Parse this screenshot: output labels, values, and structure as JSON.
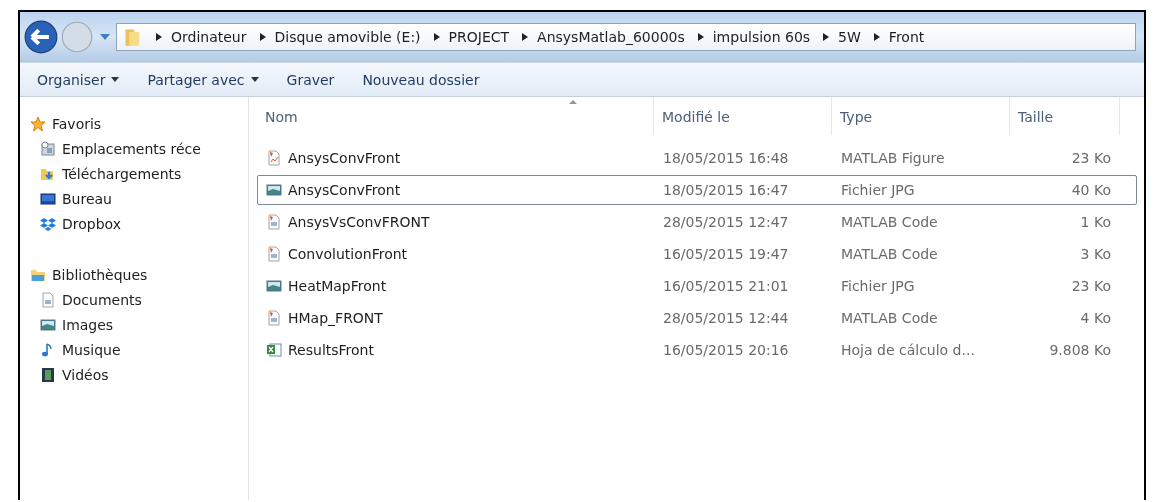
{
  "breadcrumb": [
    "Ordinateur",
    "Disque amovible (E:)",
    "PROJECT",
    "AnsysMatlab_60000s",
    "impulsion 60s",
    "5W",
    "Front"
  ],
  "toolbar": [
    {
      "label": "Organiser",
      "dropdown": true
    },
    {
      "label": "Partager avec",
      "dropdown": true
    },
    {
      "label": "Graver",
      "dropdown": false
    },
    {
      "label": "Nouveau dossier",
      "dropdown": false
    }
  ],
  "sidebar": {
    "groups": [
      {
        "label": "Favoris",
        "kind": "star",
        "items": [
          {
            "label": "Emplacements réce",
            "kind": "recent"
          },
          {
            "label": "Téléchargements",
            "kind": "download"
          },
          {
            "label": "Bureau",
            "kind": "desktop"
          },
          {
            "label": "Dropbox",
            "kind": "dropbox"
          }
        ]
      },
      {
        "label": "Bibliothèques",
        "kind": "library",
        "items": [
          {
            "label": "Documents",
            "kind": "documents"
          },
          {
            "label": "Images",
            "kind": "images"
          },
          {
            "label": "Musique",
            "kind": "music"
          },
          {
            "label": "Vidéos",
            "kind": "videos"
          }
        ]
      }
    ]
  },
  "table": {
    "columns": [
      "Nom",
      "Modifié le",
      "Type",
      "Taille"
    ],
    "rows": [
      {
        "kind": "figure",
        "name": "AnsysConvFront",
        "modified": "18/05/2015 16:48",
        "type": "MATLAB Figure",
        "size": "23 Ko",
        "selected": false
      },
      {
        "kind": "image",
        "name": "AnsysConvFront",
        "modified": "18/05/2015 16:47",
        "type": "Fichier JPG",
        "size": "40 Ko",
        "selected": true
      },
      {
        "kind": "code",
        "name": "AnsysVsConvFRONT",
        "modified": "28/05/2015 12:47",
        "type": "MATLAB Code",
        "size": "1 Ko",
        "selected": false
      },
      {
        "kind": "code",
        "name": "ConvolutionFront",
        "modified": "16/05/2015 19:47",
        "type": "MATLAB Code",
        "size": "3 Ko",
        "selected": false
      },
      {
        "kind": "image",
        "name": "HeatMapFront",
        "modified": "16/05/2015 21:01",
        "type": "Fichier JPG",
        "size": "23 Ko",
        "selected": false
      },
      {
        "kind": "code",
        "name": "HMap_FRONT",
        "modified": "28/05/2015 12:44",
        "type": "MATLAB Code",
        "size": "4 Ko",
        "selected": false
      },
      {
        "kind": "spreadsheet",
        "name": "ResultsFront",
        "modified": "16/05/2015 20:16",
        "type": "Hoja de cálculo d...",
        "size": "9.808 Ko",
        "selected": false
      }
    ]
  }
}
